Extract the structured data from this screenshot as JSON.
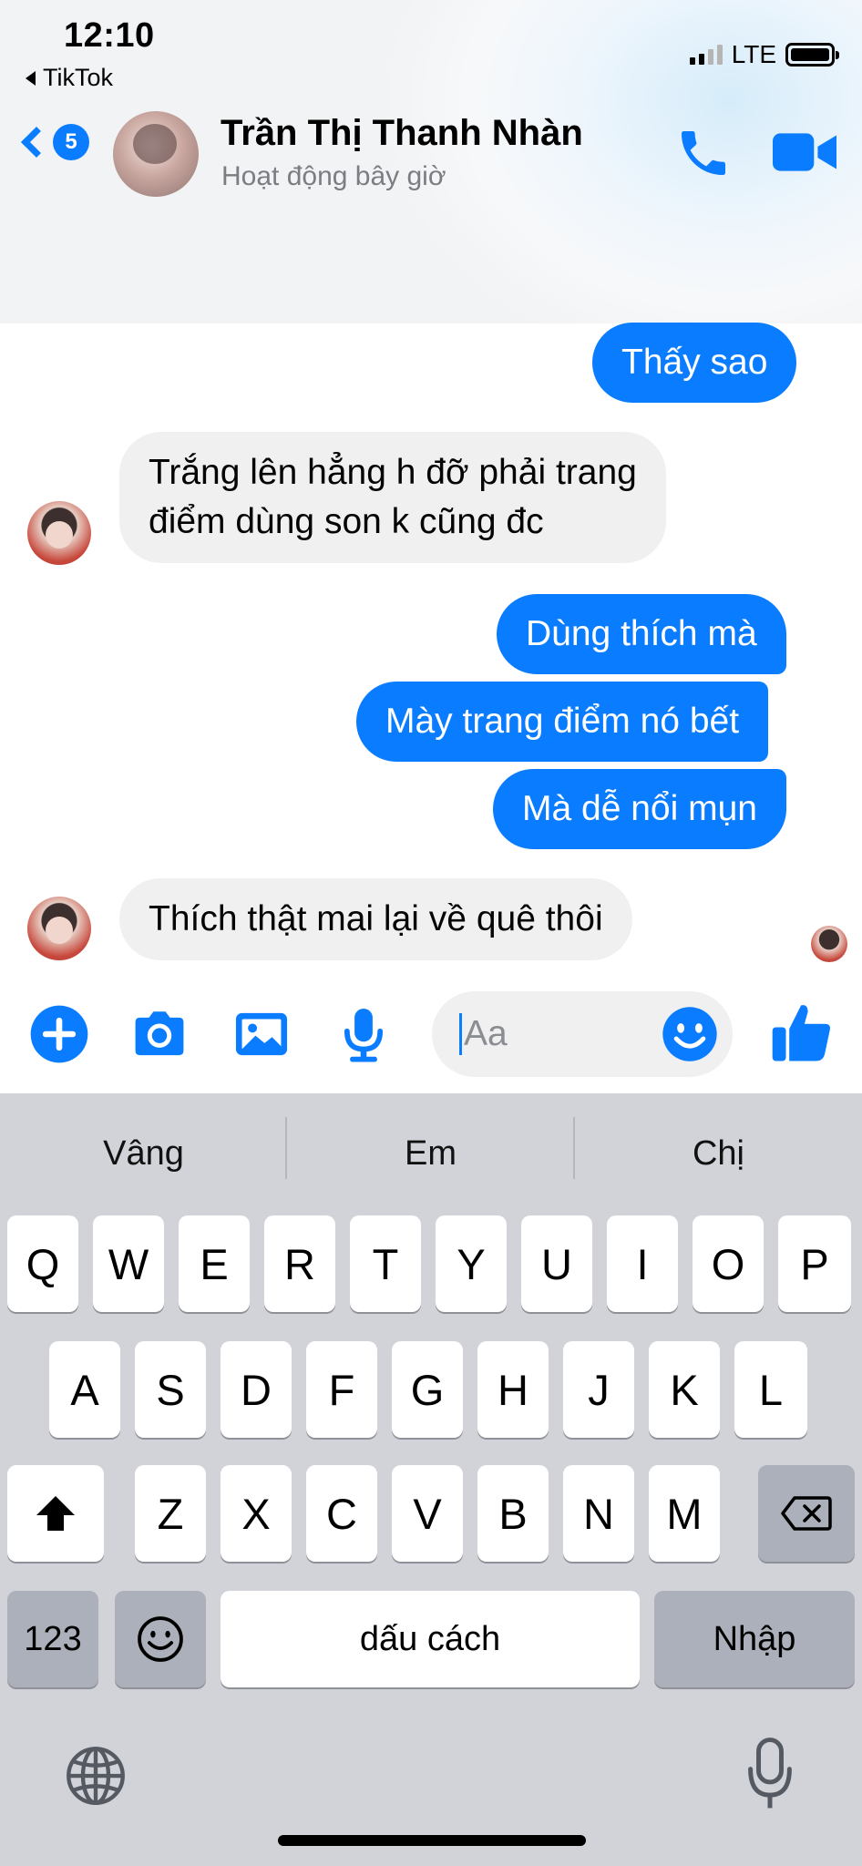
{
  "status_bar": {
    "time": "12:10",
    "back_app": "TikTok",
    "network": "LTE"
  },
  "header": {
    "unread_count": "5",
    "contact_name": "Trần Thị Thanh Nhàn",
    "active_status": "Hoạt động bây giờ",
    "accent_color": "#0a7cff"
  },
  "messages": [
    {
      "from": "me",
      "text": "Thấy sao"
    },
    {
      "from": "them",
      "lines": [
        "Trắng lên hẳng h đỡ phải trang",
        "điểm dùng son k cũng đc"
      ]
    },
    {
      "from": "me",
      "text": "Dùng thích mà"
    },
    {
      "from": "me",
      "text": "Mày trang điểm nó bết"
    },
    {
      "from": "me",
      "text": "Mà dễ nổi mụn"
    },
    {
      "from": "them",
      "text": "Thích thật mai lại về quê thôi"
    }
  ],
  "composer": {
    "placeholder": "Aa",
    "icons": [
      "plus-icon",
      "camera-icon",
      "image-icon",
      "microphone-icon",
      "emoji-icon",
      "thumbs-up-icon"
    ]
  },
  "keyboard": {
    "suggestions": [
      "Vâng",
      "Em",
      "Chị"
    ],
    "row1": [
      "Q",
      "W",
      "E",
      "R",
      "T",
      "Y",
      "U",
      "I",
      "O",
      "P"
    ],
    "row2": [
      "A",
      "S",
      "D",
      "F",
      "G",
      "H",
      "J",
      "K",
      "L"
    ],
    "row3": [
      "Z",
      "X",
      "C",
      "V",
      "B",
      "N",
      "M"
    ],
    "numbers_key": "123",
    "space_key": "dấu cách",
    "return_key": "Nhập"
  }
}
